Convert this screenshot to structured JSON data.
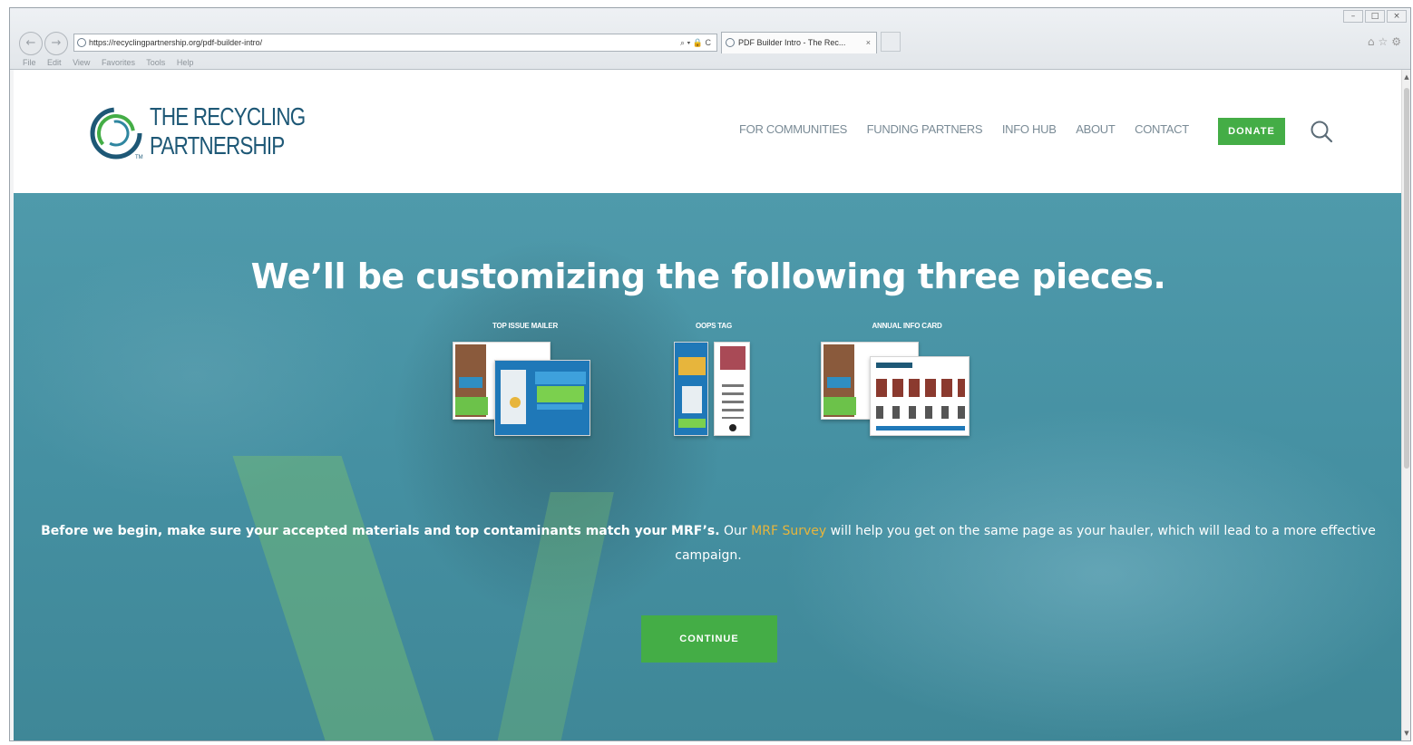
{
  "browser": {
    "url": "https://recyclingpartnership.org/pdf-builder-intro/",
    "address_icons": "⌕ ▾ 🔒 C",
    "tab_title": "PDF Builder Intro - The Rec...",
    "tab_close": "×",
    "menu": [
      "File",
      "Edit",
      "View",
      "Favorites",
      "Tools",
      "Help"
    ]
  },
  "site": {
    "logo_line1": "THE RECYCLING",
    "logo_line2": "PARTNERSHIP",
    "logo_tm": "TM",
    "nav": [
      "FOR COMMUNITIES",
      "FUNDING PARTNERS",
      "INFO HUB",
      "ABOUT",
      "CONTACT"
    ],
    "donate_label": "DONATE"
  },
  "hero": {
    "title": "We’ll be customizing the following three pieces.",
    "pieces": [
      {
        "label": "TOP ISSUE MAILER"
      },
      {
        "label": "OOPS TAG"
      },
      {
        "label": "ANNUAL INFO CARD"
      }
    ],
    "intro_bold": "Before we begin, make sure your accepted materials and top contaminants match your MRF’s.",
    "intro_pre_link": " Our ",
    "intro_link": "MRF Survey",
    "intro_post_link": " will help you get on the same page as your hauler, which will lead to a more effective campaign.",
    "continue_label": "CONTINUE"
  },
  "colors": {
    "brand_navy": "#1e5876",
    "brand_green": "#44ad46",
    "hero_teal": "#4590a2",
    "link_gold": "#e7b53c"
  }
}
